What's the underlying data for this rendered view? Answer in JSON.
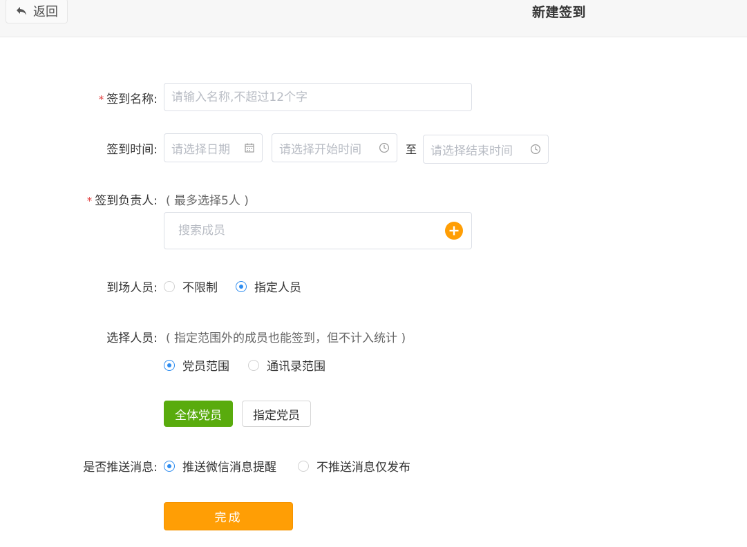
{
  "header": {
    "back_label": "返回",
    "title": "新建签到"
  },
  "form": {
    "name": {
      "label": "签到名称:",
      "required": "*",
      "placeholder": "请输入名称,不超过12个字"
    },
    "time": {
      "label": "签到时间:",
      "date_placeholder": "请选择日期",
      "start_placeholder": "请选择开始时间",
      "separator": "至",
      "end_placeholder": "请选择结束时间"
    },
    "owner": {
      "label": "签到负责人:",
      "required": "*",
      "hint": "( 最多选择5人 )",
      "search_placeholder": "搜索成员"
    },
    "attendees": {
      "label": "到场人员:",
      "options": [
        "不限制",
        "指定人员"
      ],
      "selected": "指定人员"
    },
    "select_people": {
      "label": "选择人员:",
      "hint": "( 指定范围外的成员也能签到，但不计入统计 )",
      "options": [
        "党员范围",
        "通讯录范围"
      ],
      "selected": "党员范围",
      "buttons": [
        "全体党员",
        "指定党员"
      ],
      "active_button": "全体党员"
    },
    "push": {
      "label": "是否推送消息:",
      "options": [
        "推送微信消息提醒",
        "不推送消息仅发布"
      ],
      "selected": "推送微信消息提醒"
    },
    "submit_label": "完成"
  },
  "colors": {
    "accent_blue": "#2d8cf0",
    "green": "#59ab0d",
    "orange": "#ff9e05",
    "required_red": "#e24141"
  }
}
